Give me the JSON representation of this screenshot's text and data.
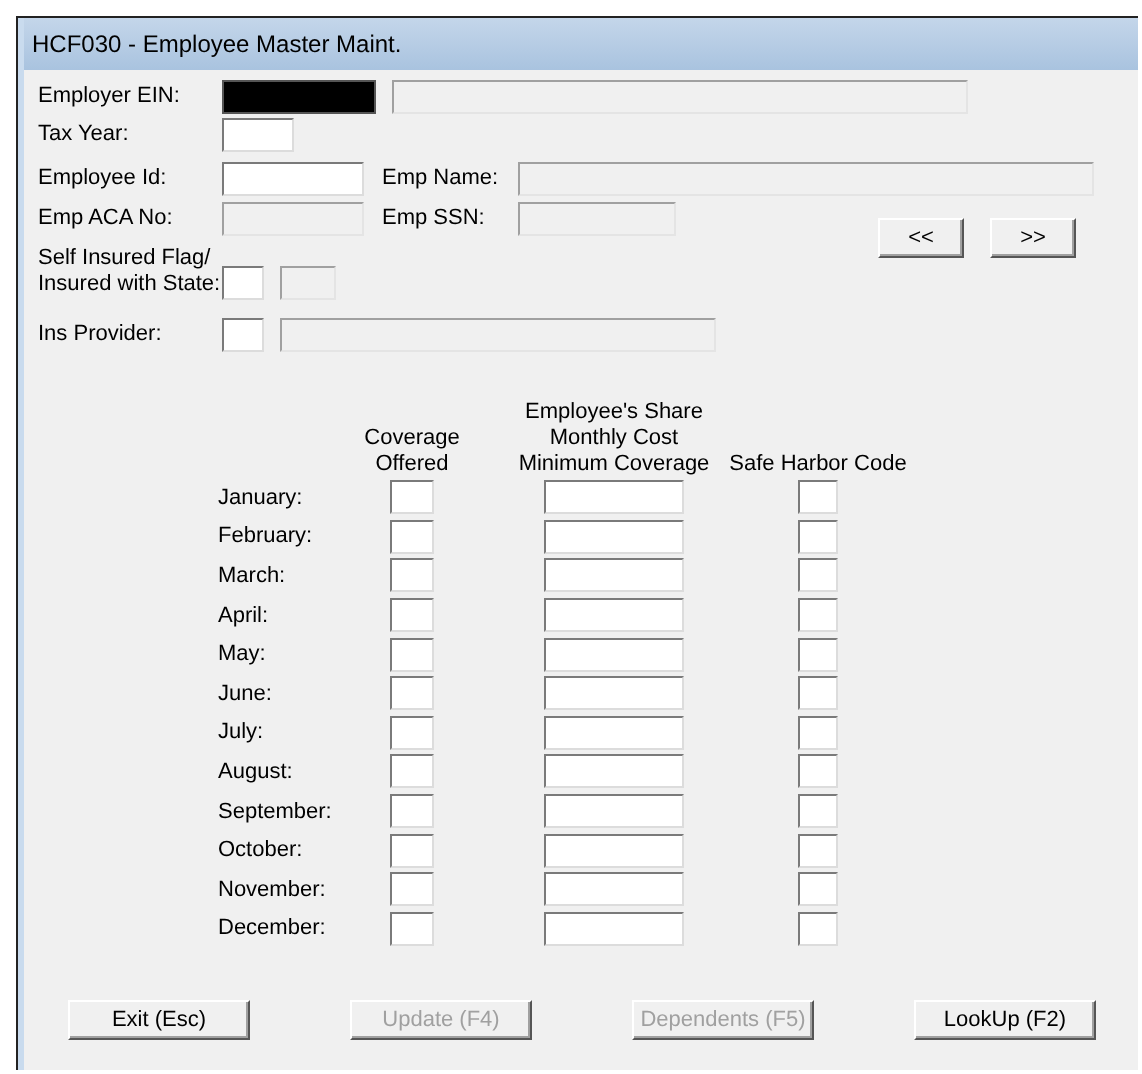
{
  "window": {
    "title": "HCF030 - Employee Master Maint."
  },
  "employer_ein": {
    "label": "Employer EIN:",
    "redacted": true
  },
  "employer_name": {
    "disabled": true
  },
  "tax_year": {
    "label": "Tax Year:",
    "disabled": false
  },
  "employee_id": {
    "label": "Employee Id:",
    "disabled": false
  },
  "emp_name": {
    "label": "Emp Name:",
    "disabled": true
  },
  "emp_aca_no": {
    "label": "Emp ACA No:",
    "disabled": true
  },
  "emp_ssn": {
    "label": "Emp SSN:",
    "disabled": true
  },
  "nav_buttons": [
    {
      "label": "<<"
    },
    {
      "label": ">>"
    }
  ],
  "self_insured": {
    "label": "Self Insured Flag/\nInsured with State:",
    "flag_disabled": false,
    "state_disabled": true
  },
  "ins_provider": {
    "label": "Ins Provider:",
    "code_disabled": false,
    "name_disabled": true
  },
  "coverage": {
    "columns": [
      "Coverage\nOffered",
      "Employee's Share\nMonthly Cost\nMinimum Coverage",
      "Safe Harbor Code"
    ],
    "months": [
      {
        "label": "January:"
      },
      {
        "label": "February:"
      },
      {
        "label": "March:"
      },
      {
        "label": "April:"
      },
      {
        "label": "May:"
      },
      {
        "label": "June:"
      },
      {
        "label": "July:"
      },
      {
        "label": "August:"
      },
      {
        "label": "September:"
      },
      {
        "label": "October:"
      },
      {
        "label": "November:"
      },
      {
        "label": "December:"
      }
    ]
  },
  "buttons": [
    {
      "label": "Exit (Esc)",
      "disabled": false
    },
    {
      "label": "Update (F4)",
      "disabled": true
    },
    {
      "label": "Dependents (F5)",
      "disabled": true
    },
    {
      "label": "LookUp (F2)",
      "disabled": false
    }
  ]
}
